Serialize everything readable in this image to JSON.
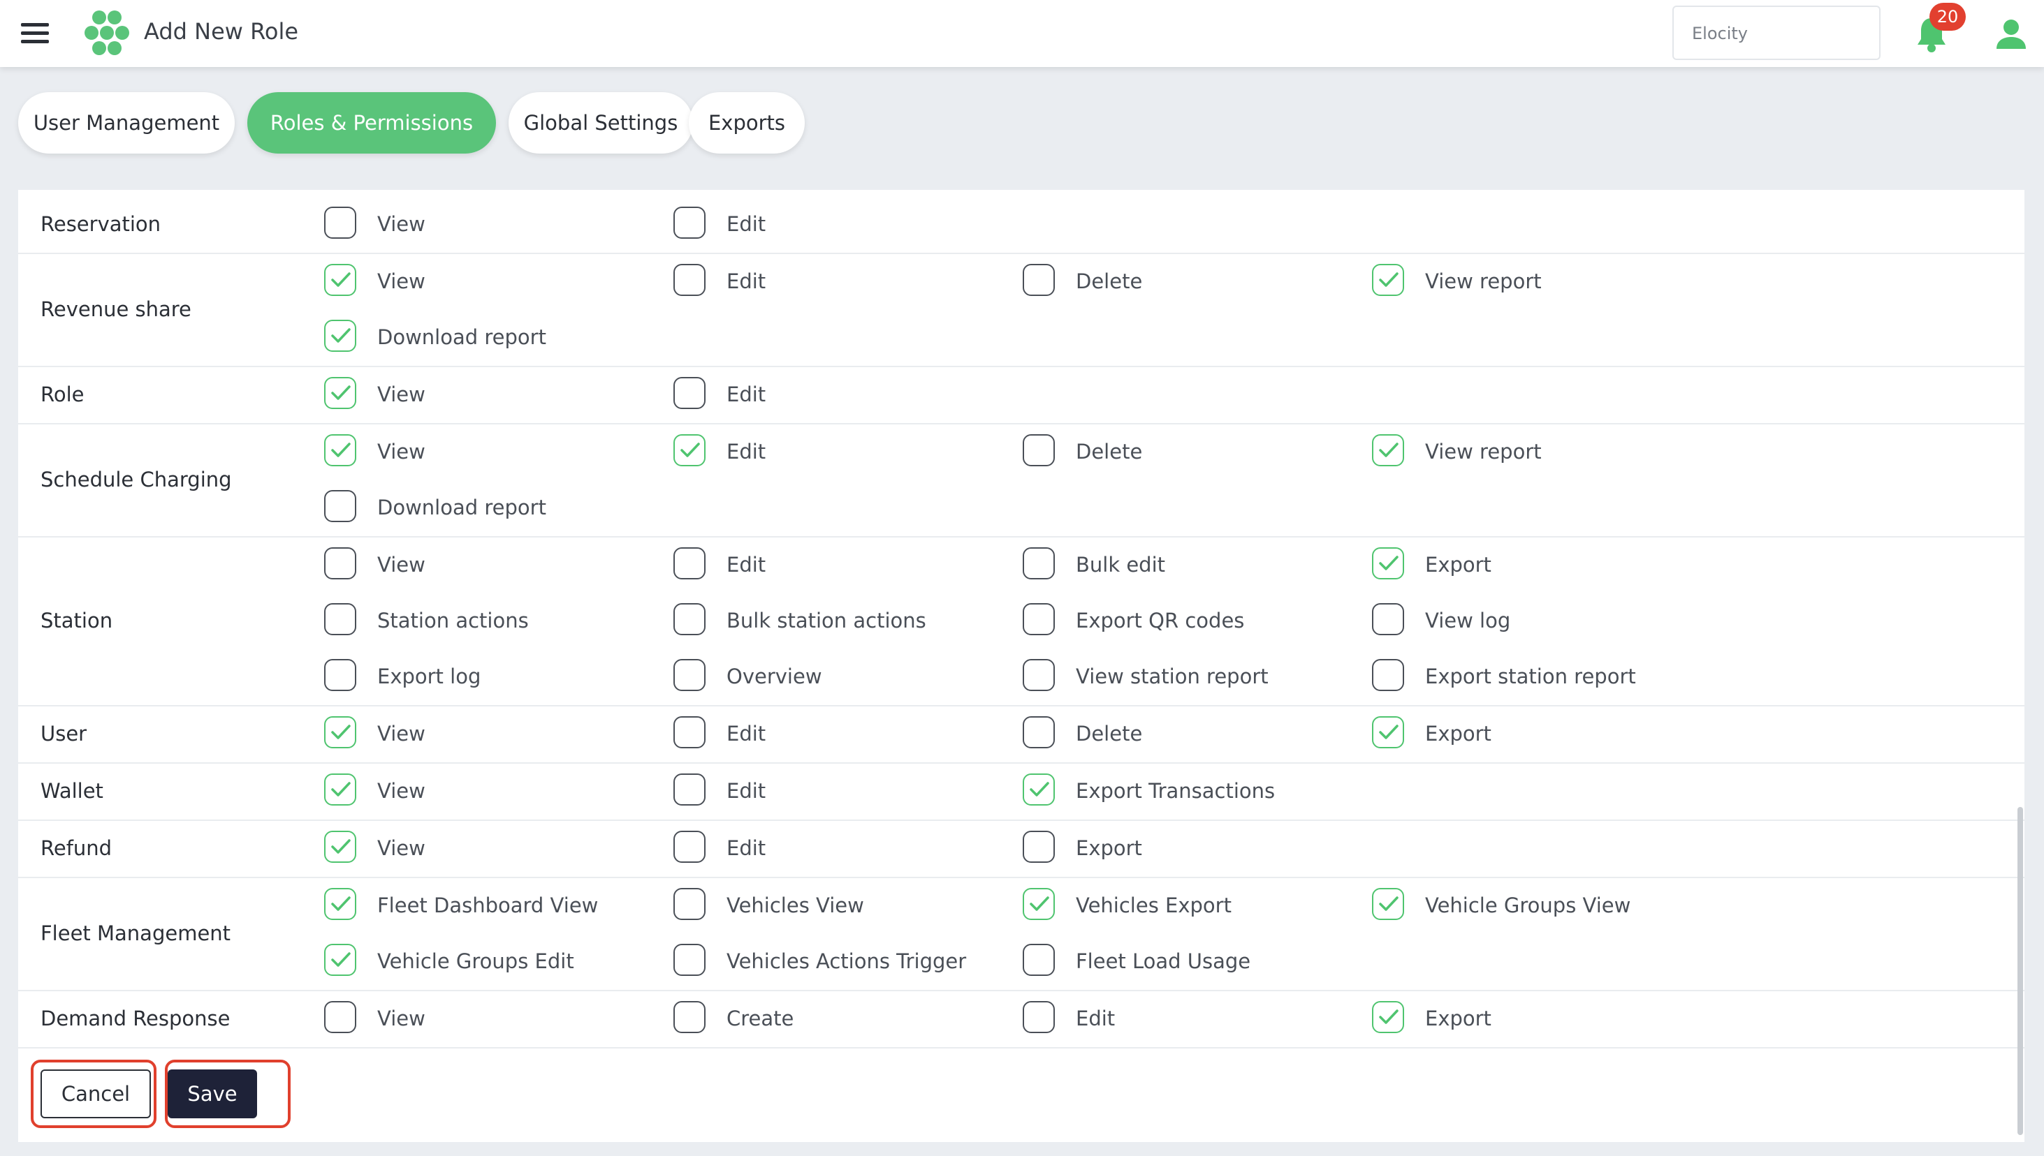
{
  "header": {
    "title": "Add New Role",
    "organization": "Elocity",
    "notification_count": "20",
    "icons": {
      "menu": "hamburger-menu-icon",
      "logo": "hexagon-cluster-logo",
      "bell": "bell-icon",
      "user": "user-icon"
    }
  },
  "tabs": [
    {
      "label": "User Management",
      "active": false
    },
    {
      "label": "Roles & Permissions",
      "active": true
    },
    {
      "label": "Global Settings",
      "active": false
    },
    {
      "label": "Exports",
      "active": false
    }
  ],
  "colors": {
    "accent": "#5ac47a",
    "check": "#4fc46f",
    "save_button": "#1e2238",
    "badge": "#e2402f",
    "highlight": "#e0402d"
  },
  "permissions": [
    {
      "module": "Reservation",
      "items": [
        {
          "label": "View",
          "checked": false
        },
        {
          "label": "Edit",
          "checked": false
        }
      ]
    },
    {
      "module": "Revenue share",
      "items": [
        {
          "label": "View",
          "checked": true
        },
        {
          "label": "Edit",
          "checked": false
        },
        {
          "label": "Delete",
          "checked": false
        },
        {
          "label": "View report",
          "checked": true
        },
        {
          "label": "Download report",
          "checked": true
        }
      ]
    },
    {
      "module": "Role",
      "items": [
        {
          "label": "View",
          "checked": true
        },
        {
          "label": "Edit",
          "checked": false
        }
      ]
    },
    {
      "module": "Schedule Charging",
      "items": [
        {
          "label": "View",
          "checked": true
        },
        {
          "label": "Edit",
          "checked": true
        },
        {
          "label": "Delete",
          "checked": false
        },
        {
          "label": "View report",
          "checked": true
        },
        {
          "label": "Download report",
          "checked": false
        }
      ]
    },
    {
      "module": "Station",
      "items": [
        {
          "label": "View",
          "checked": false
        },
        {
          "label": "Edit",
          "checked": false
        },
        {
          "label": "Bulk edit",
          "checked": false
        },
        {
          "label": "Export",
          "checked": true
        },
        {
          "label": "Station actions",
          "checked": false
        },
        {
          "label": "Bulk station actions",
          "checked": false
        },
        {
          "label": "Export QR codes",
          "checked": false
        },
        {
          "label": "View log",
          "checked": false
        },
        {
          "label": "Export log",
          "checked": false
        },
        {
          "label": "Overview",
          "checked": false
        },
        {
          "label": "View station report",
          "checked": false
        },
        {
          "label": "Export station report",
          "checked": false
        }
      ]
    },
    {
      "module": "User",
      "items": [
        {
          "label": "View",
          "checked": true
        },
        {
          "label": "Edit",
          "checked": false
        },
        {
          "label": "Delete",
          "checked": false
        },
        {
          "label": "Export",
          "checked": true
        }
      ]
    },
    {
      "module": "Wallet",
      "items": [
        {
          "label": "View",
          "checked": true
        },
        {
          "label": "Edit",
          "checked": false
        },
        {
          "label": "Export Transactions",
          "checked": true
        }
      ]
    },
    {
      "module": "Refund",
      "items": [
        {
          "label": "View",
          "checked": true
        },
        {
          "label": "Edit",
          "checked": false
        },
        {
          "label": "Export",
          "checked": false
        }
      ]
    },
    {
      "module": "Fleet Management",
      "items": [
        {
          "label": "Fleet Dashboard View",
          "checked": true
        },
        {
          "label": "Vehicles View",
          "checked": false
        },
        {
          "label": "Vehicles Export",
          "checked": true
        },
        {
          "label": "Vehicle Groups View",
          "checked": true
        },
        {
          "label": "Vehicle Groups Edit",
          "checked": true
        },
        {
          "label": "Vehicles Actions Trigger",
          "checked": false
        },
        {
          "label": "Fleet Load Usage",
          "checked": false
        }
      ]
    },
    {
      "module": "Demand Response",
      "items": [
        {
          "label": "View",
          "checked": false
        },
        {
          "label": "Create",
          "checked": false
        },
        {
          "label": "Edit",
          "checked": false
        },
        {
          "label": "Export",
          "checked": true
        }
      ]
    }
  ],
  "actions": {
    "cancel_label": "Cancel",
    "save_label": "Save"
  }
}
